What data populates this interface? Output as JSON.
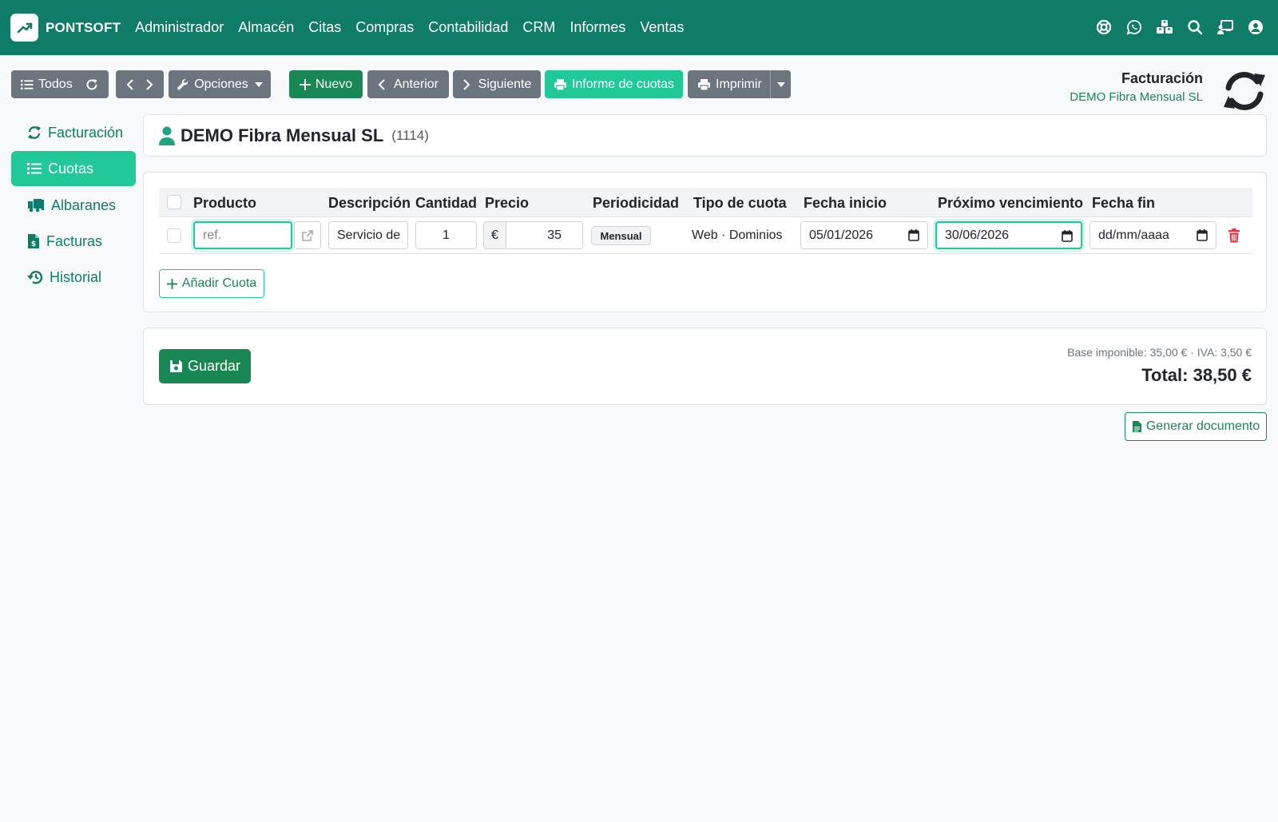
{
  "navbar": {
    "brand": "PONTSOFT",
    "links": [
      "Administrador",
      "Almacén",
      "Citas",
      "Compras",
      "Contabilidad",
      "CRM",
      "Informes",
      "Ventas"
    ],
    "icons": [
      "lifebuoy-icon",
      "whatsapp-icon",
      "boxes-icon",
      "search-icon",
      "presentation-icon",
      "user-icon"
    ]
  },
  "toolbar": {
    "todos": "Todos",
    "opciones": "Opciones",
    "nuevo": "Nuevo",
    "anterior": "Anterior",
    "siguiente": "Siguiente",
    "informe": "Informe de cuotas",
    "imprimir": "Imprimir"
  },
  "header": {
    "title": "Facturación",
    "subtitle": "DEMO Fibra Mensual SL"
  },
  "sidebar": {
    "items": [
      {
        "label": "Facturación",
        "icon": "sync-icon"
      },
      {
        "label": "Cuotas",
        "icon": "list-icon"
      },
      {
        "label": "Albaranes",
        "icon": "truck-icon"
      },
      {
        "label": "Facturas",
        "icon": "invoice-icon"
      },
      {
        "label": "Historial",
        "icon": "history-icon"
      }
    ]
  },
  "client": {
    "name": "DEMO Fibra Mensual SL",
    "code": "(1114)"
  },
  "table": {
    "headers": [
      "Producto",
      "Descripción",
      "Cantidad",
      "Precio",
      "Periodicidad",
      "Tipo de cuota",
      "Fecha inicio",
      "Próximo vencimiento",
      "Fecha fin"
    ],
    "row": {
      "producto_placeholder": "ref.",
      "descripcion": "Servicio de",
      "cantidad": "1",
      "currency": "€",
      "precio": "35",
      "periodicidad": "Mensual",
      "tipo": "Web · Dominios",
      "fecha_inicio": "05/01/2026",
      "proximo_vencimiento": "30/06/2026",
      "fecha_fin_placeholder": "dd/mm/aaaa"
    },
    "add_label": "Añadir Cuota"
  },
  "footer": {
    "save": "Guardar",
    "summary": "Base imponible: 35,00 € · IVA: 3,50 €",
    "total": "Total: 38,50 €",
    "generate": "Generar documento"
  },
  "colors": {
    "navbar": "#0f7c67",
    "accent": "#20c997",
    "success": "#198754",
    "secondary": "#6c757d",
    "danger": "#dc3545"
  }
}
